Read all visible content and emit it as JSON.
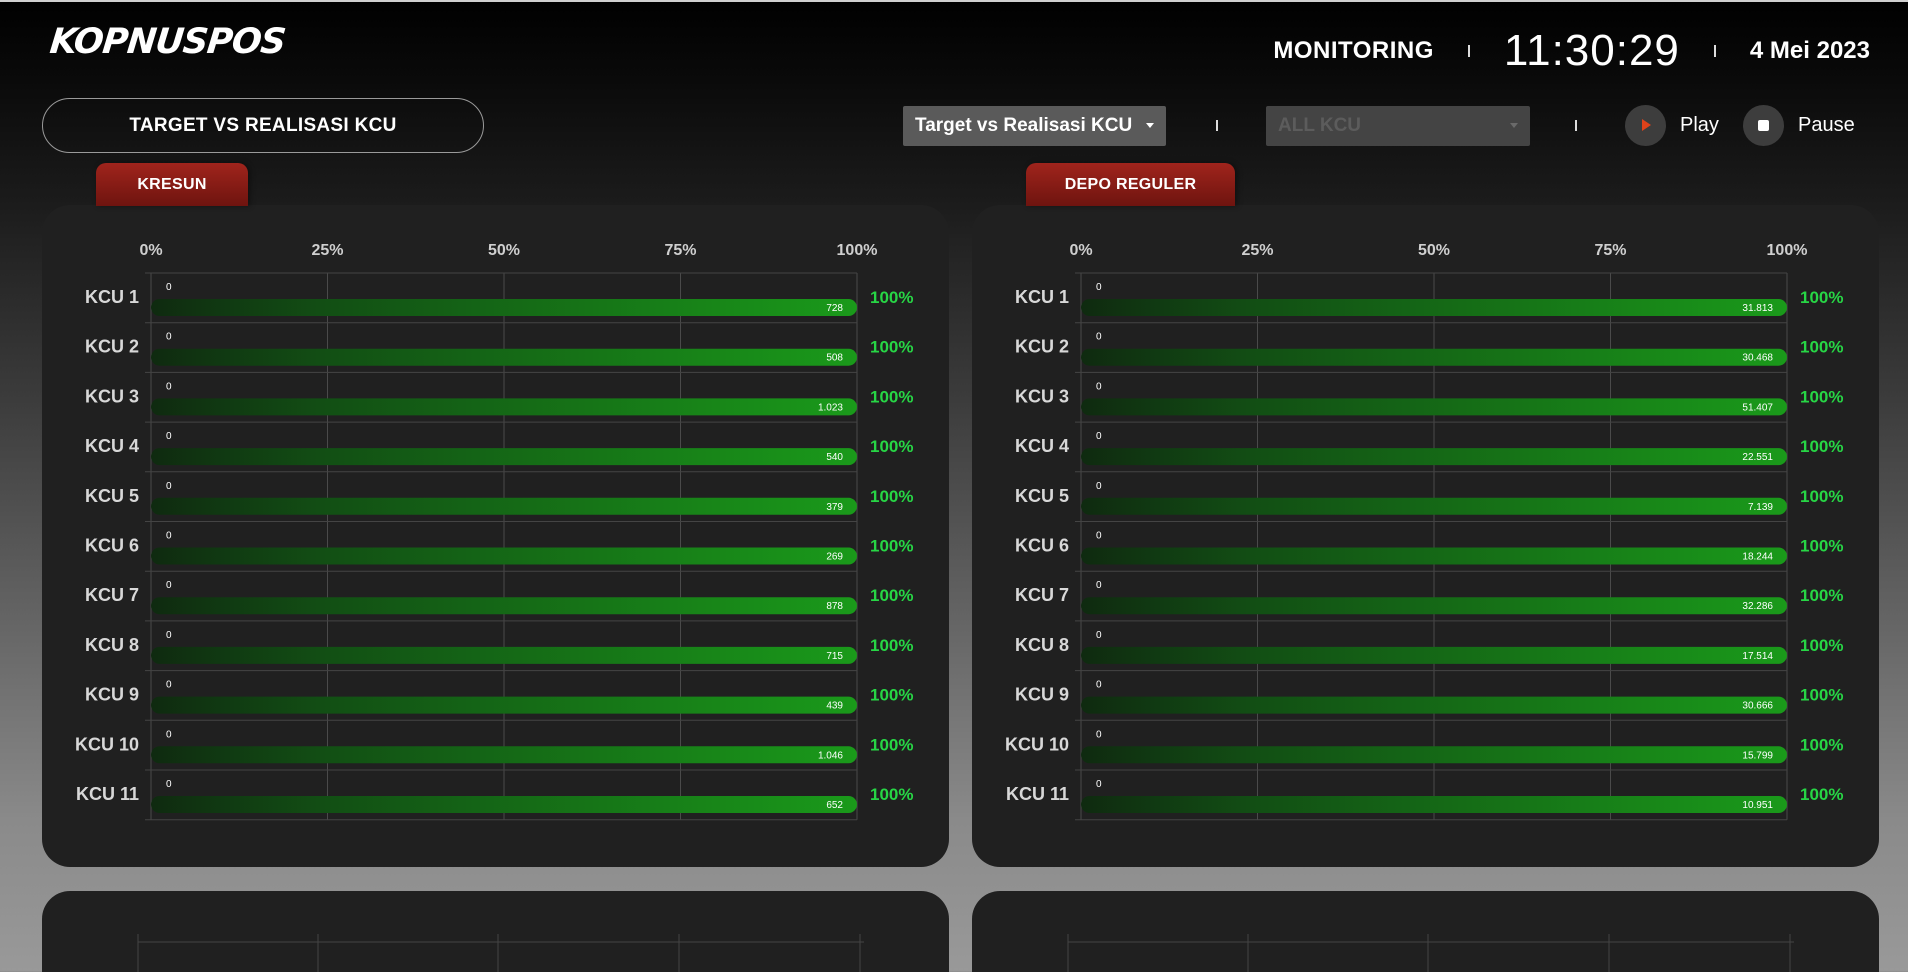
{
  "header": {
    "logo": "KOPNUSPOS",
    "monitoring_label": "MONITORING",
    "clock": "11:30:29",
    "date": "4 Mei 2023"
  },
  "toolbar": {
    "title": "TARGET VS REALISASI KCU",
    "report_select": "Target vs Realisasi KCU",
    "kcu_select": "ALL KCU",
    "play_label": "Play",
    "pause_label": "Pause"
  },
  "colors": {
    "bar_green": "#1a9a1a",
    "percent_green": "#27d645",
    "tab_red": "#a0241c",
    "play_orange": "#e0421a"
  },
  "chart_data": [
    {
      "type": "bar",
      "title": "KRESUN",
      "orientation": "horizontal",
      "xlim": [
        0,
        100
      ],
      "x_ticks": [
        "0%",
        "25%",
        "50%",
        "75%",
        "100%"
      ],
      "categories": [
        "KCU 1",
        "KCU 2",
        "KCU 3",
        "KCU 4",
        "KCU 5",
        "KCU 6",
        "KCU 7",
        "KCU 8",
        "KCU 9",
        "KCU 10",
        "KCU 11"
      ],
      "target": [
        "0",
        "0",
        "0",
        "0",
        "0",
        "0",
        "0",
        "0",
        "0",
        "0",
        "0"
      ],
      "realisasi": [
        "728",
        "508",
        "1.023",
        "540",
        "379",
        "269",
        "878",
        "715",
        "439",
        "1.046",
        "652"
      ],
      "percent_values": [
        100,
        100,
        100,
        100,
        100,
        100,
        100,
        100,
        100,
        100,
        100
      ],
      "percent_labels": [
        "100%",
        "100%",
        "100%",
        "100%",
        "100%",
        "100%",
        "100%",
        "100%",
        "100%",
        "100%",
        "100%"
      ]
    },
    {
      "type": "bar",
      "title": "DEPO REGULER",
      "orientation": "horizontal",
      "xlim": [
        0,
        100
      ],
      "x_ticks": [
        "0%",
        "25%",
        "50%",
        "75%",
        "100%"
      ],
      "categories": [
        "KCU 1",
        "KCU 2",
        "KCU 3",
        "KCU 4",
        "KCU 5",
        "KCU 6",
        "KCU 7",
        "KCU 8",
        "KCU 9",
        "KCU 10",
        "KCU 11"
      ],
      "target": [
        "0",
        "0",
        "0",
        "0",
        "0",
        "0",
        "0",
        "0",
        "0",
        "0",
        "0"
      ],
      "realisasi": [
        "31.813",
        "30.468",
        "51.407",
        "22.551",
        "7.139",
        "18.244",
        "32.286",
        "17.514",
        "30.666",
        "15.799",
        "10.951"
      ],
      "percent_values": [
        100,
        100,
        100,
        100,
        100,
        100,
        100,
        100,
        100,
        100,
        100
      ],
      "percent_labels": [
        "100%",
        "100%",
        "100%",
        "100%",
        "100%",
        "100%",
        "100%",
        "100%",
        "100%",
        "100%",
        "100%"
      ]
    }
  ]
}
